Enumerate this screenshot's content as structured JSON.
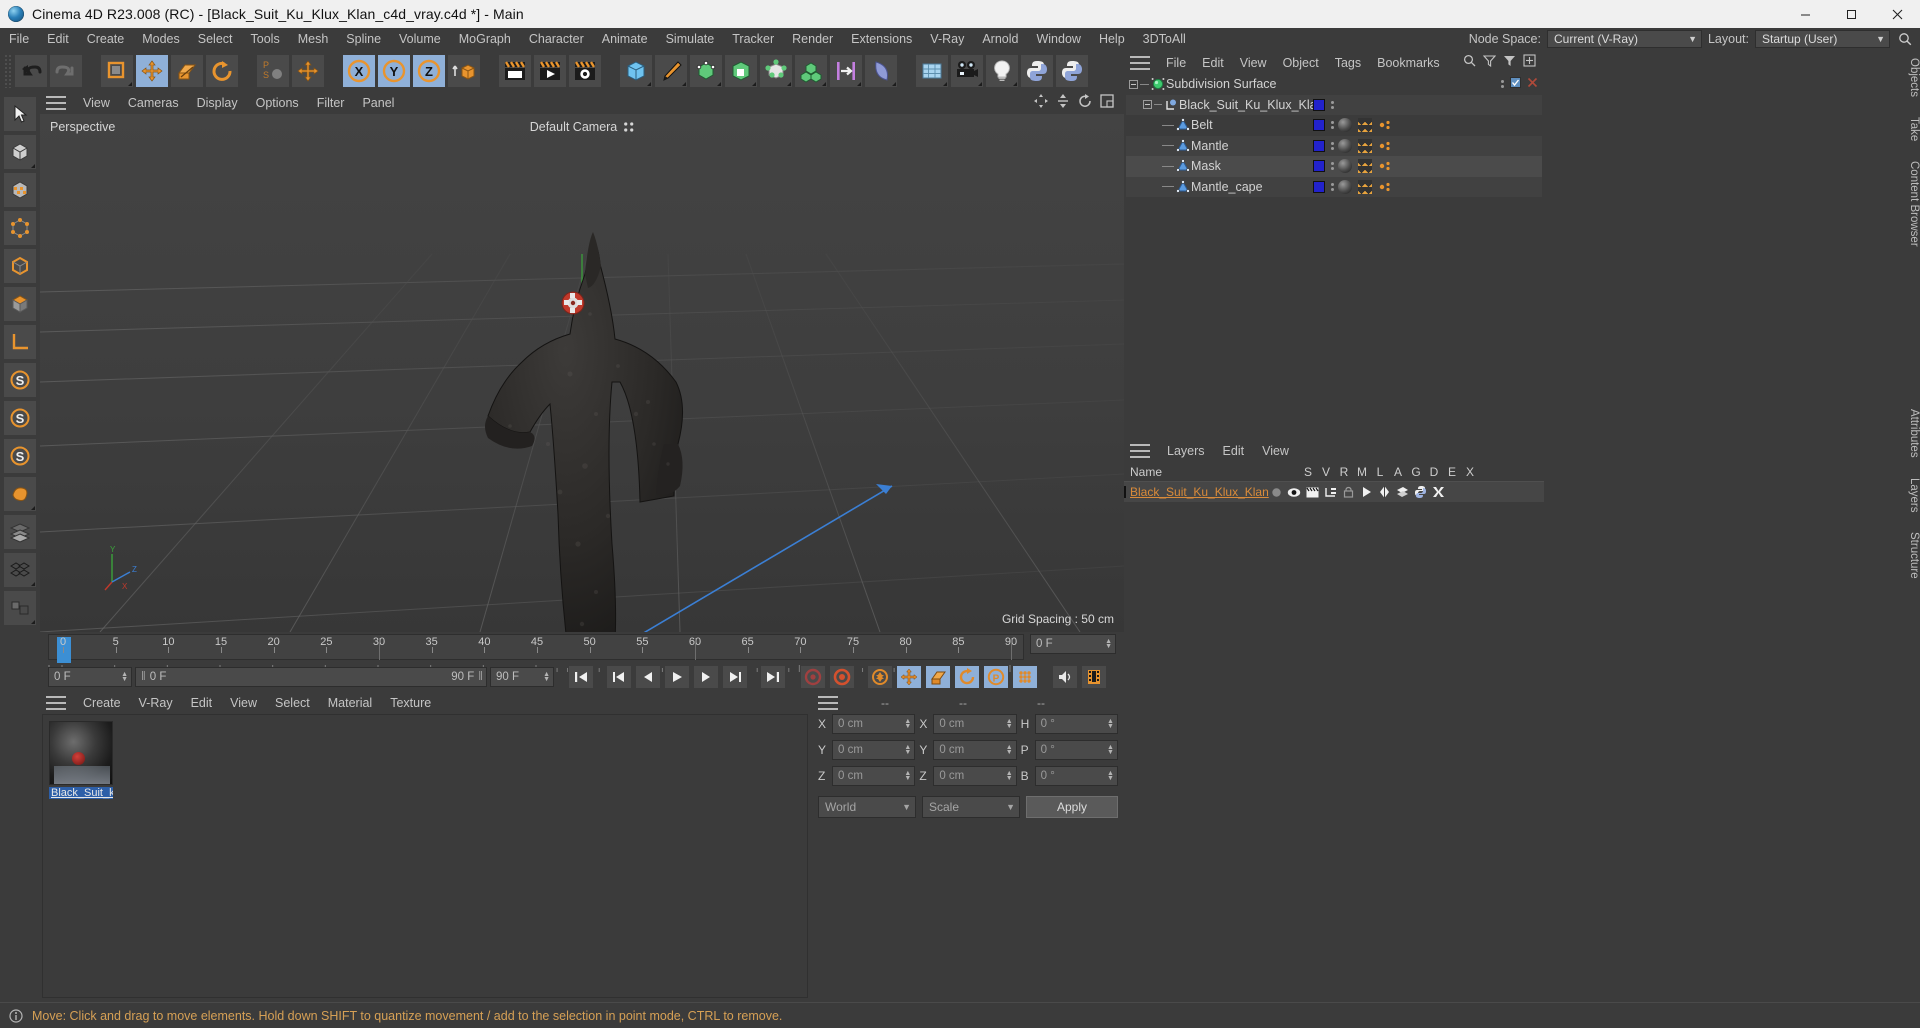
{
  "titlebar": {
    "title": "Cinema 4D R23.008 (RC) - [Black_Suit_Ku_Klux_Klan_c4d_vray.c4d *] - Main",
    "app_icon": "cinema4d-logo-icon",
    "minimize": "minimize-icon",
    "maximize": "maximize-icon",
    "close": "close-icon"
  },
  "menubar": {
    "items": [
      "File",
      "Edit",
      "Create",
      "Modes",
      "Select",
      "Tools",
      "Mesh",
      "Spline",
      "Volume",
      "MoGraph",
      "Character",
      "Animate",
      "Simulate",
      "Tracker",
      "Render",
      "Extensions",
      "V-Ray",
      "Arnold",
      "Window",
      "Help",
      "3DToAll"
    ],
    "node_space_label": "Node Space:",
    "node_space_value": "Current (V-Ray)",
    "layout_label": "Layout:",
    "layout_value": "Startup (User)",
    "search_icon": "search-icon"
  },
  "toolbar": {
    "groups": [
      {
        "buttons": [
          {
            "name": "undo-button",
            "icon": "undo-arrow-icon",
            "selected": false
          },
          {
            "name": "redo-button",
            "icon": "redo-arrow-icon",
            "selected": false
          }
        ]
      },
      {
        "buttons": [
          {
            "name": "select-tool-button",
            "icon": "live-selection-icon",
            "selected": false,
            "corner": true
          },
          {
            "name": "move-tool-button",
            "icon": "move-axes-icon",
            "selected": true
          },
          {
            "name": "scale-tool-button",
            "icon": "scale-icon",
            "selected": false
          },
          {
            "name": "rotate-tool-button",
            "icon": "rotate-icon",
            "selected": false
          }
        ]
      },
      {
        "buttons": [
          {
            "name": "psr-toggle-button",
            "icon": "psr-letters-icon",
            "selected": false
          },
          {
            "name": "world-object-axis-button",
            "icon": "move-axes-icon",
            "selected": false
          }
        ]
      },
      {
        "buttons": [
          {
            "name": "lock-x-axis-button",
            "icon": "x-axis-icon",
            "selected": true
          },
          {
            "name": "lock-y-axis-button",
            "icon": "y-axis-icon",
            "selected": true
          },
          {
            "name": "lock-z-axis-button",
            "icon": "z-axis-icon",
            "selected": true
          },
          {
            "name": "world-coordinate-button",
            "icon": "world-cube-icon",
            "selected": false
          }
        ]
      },
      {
        "buttons": [
          {
            "name": "render-view-button",
            "icon": "render-clapper-icon",
            "selected": false
          },
          {
            "name": "render-to-picture-viewer-button",
            "icon": "render-play-clapper-icon",
            "selected": false
          },
          {
            "name": "render-settings-button",
            "icon": "render-gear-clapper-icon",
            "selected": false
          }
        ]
      },
      {
        "buttons": [
          {
            "name": "add-cube-button",
            "icon": "blue-cube-icon",
            "selected": false,
            "corner": true
          },
          {
            "name": "add-spline-button",
            "icon": "pen-nib-icon",
            "selected": false,
            "corner": true
          },
          {
            "name": "add-generator-button",
            "icon": "green-subdivision-cube-icon",
            "selected": false,
            "corner": true
          },
          {
            "name": "add-spline-generator-button",
            "icon": "green-extrude-icon",
            "selected": false,
            "corner": true
          },
          {
            "name": "add-deformer-button",
            "icon": "bend-deformer-icon",
            "selected": false,
            "corner": true
          },
          {
            "name": "add-mograph-button",
            "icon": "green-cloner-icon",
            "selected": false,
            "corner": true
          },
          {
            "name": "add-field-button",
            "icon": "purple-field-icon",
            "selected": false,
            "corner": true
          },
          {
            "name": "add-scene-object-button",
            "icon": "floor-object-icon",
            "selected": false,
            "corner": true
          }
        ]
      },
      {
        "buttons": [
          {
            "name": "add-environment-button",
            "icon": "sky-grid-icon",
            "selected": false,
            "corner": true
          },
          {
            "name": "add-camera-button",
            "icon": "camera-icon",
            "selected": false,
            "corner": true
          },
          {
            "name": "add-light-button",
            "icon": "light-bulb-icon",
            "selected": false,
            "corner": true
          },
          {
            "name": "python-scripting-button",
            "icon": "python-icon",
            "selected": false
          },
          {
            "name": "python-generator-button",
            "icon": "python-icon",
            "selected": false
          }
        ]
      }
    ]
  },
  "lefttoolbar": {
    "buttons": [
      {
        "name": "model-mode-button",
        "icon": "cursor-arrow-icon",
        "corner": false
      },
      {
        "name": "object-mode-button",
        "icon": "object-cube-icon",
        "corner": true
      },
      {
        "name": "texture-mode-button",
        "icon": "texture-checker-cube-icon",
        "corner": false
      },
      {
        "name": "points-mode-button",
        "icon": "points-cube-icon",
        "corner": false
      },
      {
        "name": "edges-mode-button",
        "icon": "edges-cube-icon",
        "corner": false
      },
      {
        "name": "polygons-mode-button",
        "icon": "polygons-cube-icon",
        "corner": false
      },
      {
        "name": "workplane-button",
        "icon": "workplane-icon",
        "corner": false
      },
      {
        "name": "enable-axis-button",
        "icon": "axis-s-icon",
        "corner": false
      },
      {
        "name": "enable-snap-button",
        "icon": "snap-s-icon",
        "corner": false
      },
      {
        "name": "quantize-button",
        "icon": "quantize-s-icon",
        "corner": false
      },
      {
        "name": "viewport-solo-button",
        "icon": "solo-icon",
        "corner": true
      },
      {
        "name": "layers-filter-button",
        "icon": "layer-stack-icon",
        "corner": false
      },
      {
        "name": "grid-display-button",
        "icon": "grid-cubes-icon",
        "corner": true
      },
      {
        "name": "render-region-button",
        "icon": "render-region-icon",
        "corner": true
      }
    ]
  },
  "viewport": {
    "menu": [
      "View",
      "Cameras",
      "Display",
      "Options",
      "Filter",
      "Panel"
    ],
    "menu_icon": "hamburger-icon",
    "nav_icons": [
      "pan-icon",
      "dolly-icon",
      "rotate-icon",
      "maximize-viewport-icon"
    ],
    "perspective_label": "Perspective",
    "camera_label": "Default Camera",
    "grid_spacing": "Grid Spacing : 50 cm",
    "axis_labels": {
      "x": "X",
      "y": "Y",
      "z": "Z"
    },
    "model_description": "black hooded robe 3d model"
  },
  "timeline": {
    "start_frame_field": "0 F",
    "end_frame_field": "90 F",
    "current_frame_field": "0 F",
    "preview_min_field": "0 F",
    "preview_max_field": "90 F",
    "ruler_ticks": [
      0,
      5,
      10,
      15,
      20,
      25,
      30,
      35,
      40,
      45,
      50,
      55,
      60,
      65,
      70,
      75,
      80,
      85,
      90
    ],
    "transport": [
      {
        "name": "go-to-start-button",
        "icon": "skip-start-icon"
      },
      {
        "name": "go-to-previous-key-button",
        "icon": "prev-key-icon"
      },
      {
        "name": "step-back-button",
        "icon": "step-back-icon"
      },
      {
        "name": "play-button",
        "icon": "play-icon"
      },
      {
        "name": "step-forward-button",
        "icon": "step-forward-icon"
      },
      {
        "name": "go-to-next-key-button",
        "icon": "next-key-icon"
      },
      {
        "name": "go-to-end-button",
        "icon": "skip-end-icon"
      }
    ],
    "record_controls": [
      {
        "name": "record-active-objects-button",
        "icon": "record-circle-icon",
        "color": "#a04040"
      },
      {
        "name": "autokeying-button",
        "icon": "autokey-icon",
        "color": "#d4512e"
      },
      {
        "name": "keyframe-selection-button",
        "icon": "keyframe-gear-icon",
        "color": "#e08a2a"
      },
      {
        "name": "position-key-button",
        "icon": "position-key-icon",
        "color": "#e08a2a",
        "selected": true
      },
      {
        "name": "scale-key-button",
        "icon": "scale-key-icon",
        "color": "#e08a2a",
        "selected": true
      },
      {
        "name": "rotation-key-button",
        "icon": "rotation-key-icon",
        "color": "#e08a2a",
        "selected": true
      },
      {
        "name": "parameter-key-button",
        "icon": "param-key-icon",
        "color": "#e08a2a",
        "selected": true
      },
      {
        "name": "point-level-animation-button",
        "icon": "pla-dots-icon",
        "color": "#e08a2a",
        "selected": true
      }
    ],
    "extra_controls": [
      {
        "name": "sound-button",
        "icon": "sound-wave-icon"
      },
      {
        "name": "film-button",
        "icon": "film-strip-icon"
      }
    ]
  },
  "material_manager": {
    "menu": [
      "Create",
      "V-Ray",
      "Edit",
      "View",
      "Select",
      "Material",
      "Texture"
    ],
    "menu_icon": "hamburger-icon",
    "materials": [
      {
        "name": "Black_Suit_k",
        "selected": true
      }
    ]
  },
  "coordinates": {
    "menu_icon": "hamburger-icon",
    "headers": [
      "--",
      "--",
      "--"
    ],
    "rows": [
      {
        "label1": "X",
        "value1": "0 cm",
        "label2": "X",
        "value2": "0 cm",
        "label3": "H",
        "value3": "0 °"
      },
      {
        "label1": "Y",
        "value1": "0 cm",
        "label2": "Y",
        "value2": "0 cm",
        "label3": "P",
        "value3": "0 °"
      },
      {
        "label1": "Z",
        "value1": "0 cm",
        "label2": "Z",
        "value2": "0 cm",
        "label3": "B",
        "value3": "0 °"
      }
    ],
    "system_select": "World",
    "mode_select": "Scale",
    "apply_button": "Apply"
  },
  "object_manager": {
    "menu": [
      "File",
      "Edit",
      "View",
      "Object",
      "Tags",
      "Bookmarks"
    ],
    "menu_icon": "hamburger-icon",
    "header_icons": [
      "search-icon",
      "filter-up-icon",
      "filter-down-icon",
      "add-layout-icon"
    ],
    "rows": [
      {
        "name": "Subdivision Surface",
        "depth": 0,
        "icon": "subdivision-surface-icon",
        "expandable": true,
        "tags": [],
        "visibility_dots": true,
        "has_green_x": true
      },
      {
        "name": "Black_Suit_Ku_Klux_Klan",
        "depth": 1,
        "icon": "null-object-icon",
        "expandable": true,
        "tags": [],
        "swatch": "#2222cc",
        "visibility_dots": true
      },
      {
        "name": "Belt",
        "depth": 2,
        "icon": "polygon-object-icon",
        "expandable": false,
        "tags": [
          "sphere-material-tag",
          "checker-texture-tag",
          "uv-tag"
        ],
        "swatch": "#2222cc",
        "visibility_dots": true
      },
      {
        "name": "Mantle",
        "depth": 2,
        "icon": "polygon-object-icon",
        "expandable": false,
        "tags": [
          "sphere-material-tag",
          "checker-texture-tag",
          "uv-tag"
        ],
        "swatch": "#2222cc",
        "visibility_dots": true
      },
      {
        "name": "Mask",
        "depth": 2,
        "icon": "polygon-object-icon",
        "expandable": false,
        "tags": [
          "sphere-material-tag",
          "checker-texture-tag",
          "uv-tag"
        ],
        "swatch": "#2222cc",
        "visibility_dots": true,
        "selected": true
      },
      {
        "name": "Mantle_cape",
        "depth": 2,
        "icon": "polygon-object-icon",
        "expandable": false,
        "tags": [
          "sphere-material-tag",
          "checker-texture-tag",
          "uv-tag"
        ],
        "swatch": "#2222cc",
        "visibility_dots": true
      }
    ]
  },
  "layers_panel": {
    "menu": [
      "Layers",
      "Edit",
      "View"
    ],
    "menu_icon": "hamburger-icon",
    "column_name": "Name",
    "columns": [
      "S",
      "V",
      "R",
      "M",
      "L",
      "A",
      "G",
      "D",
      "E",
      "X"
    ],
    "rows": [
      {
        "name": "Black_Suit_Ku_Klux_Klan",
        "color": "#2222cc",
        "icons": [
          "solo-dot-icon",
          "visible-eye-icon",
          "render-clapper-icon",
          "manager-tree-icon",
          "lock-icon",
          "animation-play-icon",
          "generators-icon",
          "deformers-icon",
          "expressions-icon",
          "xref-icon"
        ]
      }
    ]
  },
  "right_dock": {
    "items": [
      "Objects",
      "Take",
      "Content Browser",
      "Attributes",
      "Layers",
      "Structure"
    ]
  },
  "statusbar": {
    "icon": "info-icon",
    "message": "Move: Click and drag to move elements. Hold down SHIFT to quantize movement / add to the selection in point mode, CTRL to remove."
  },
  "colors": {
    "accent_orange": "#e08a2a",
    "selection_blue": "#8fb0d8",
    "layer_blue": "#2222cc",
    "layer_text": "#d98b3a",
    "status_text": "#d6a055",
    "panel_bg": "#3b3b3b",
    "viewport_bg": "#434343"
  }
}
